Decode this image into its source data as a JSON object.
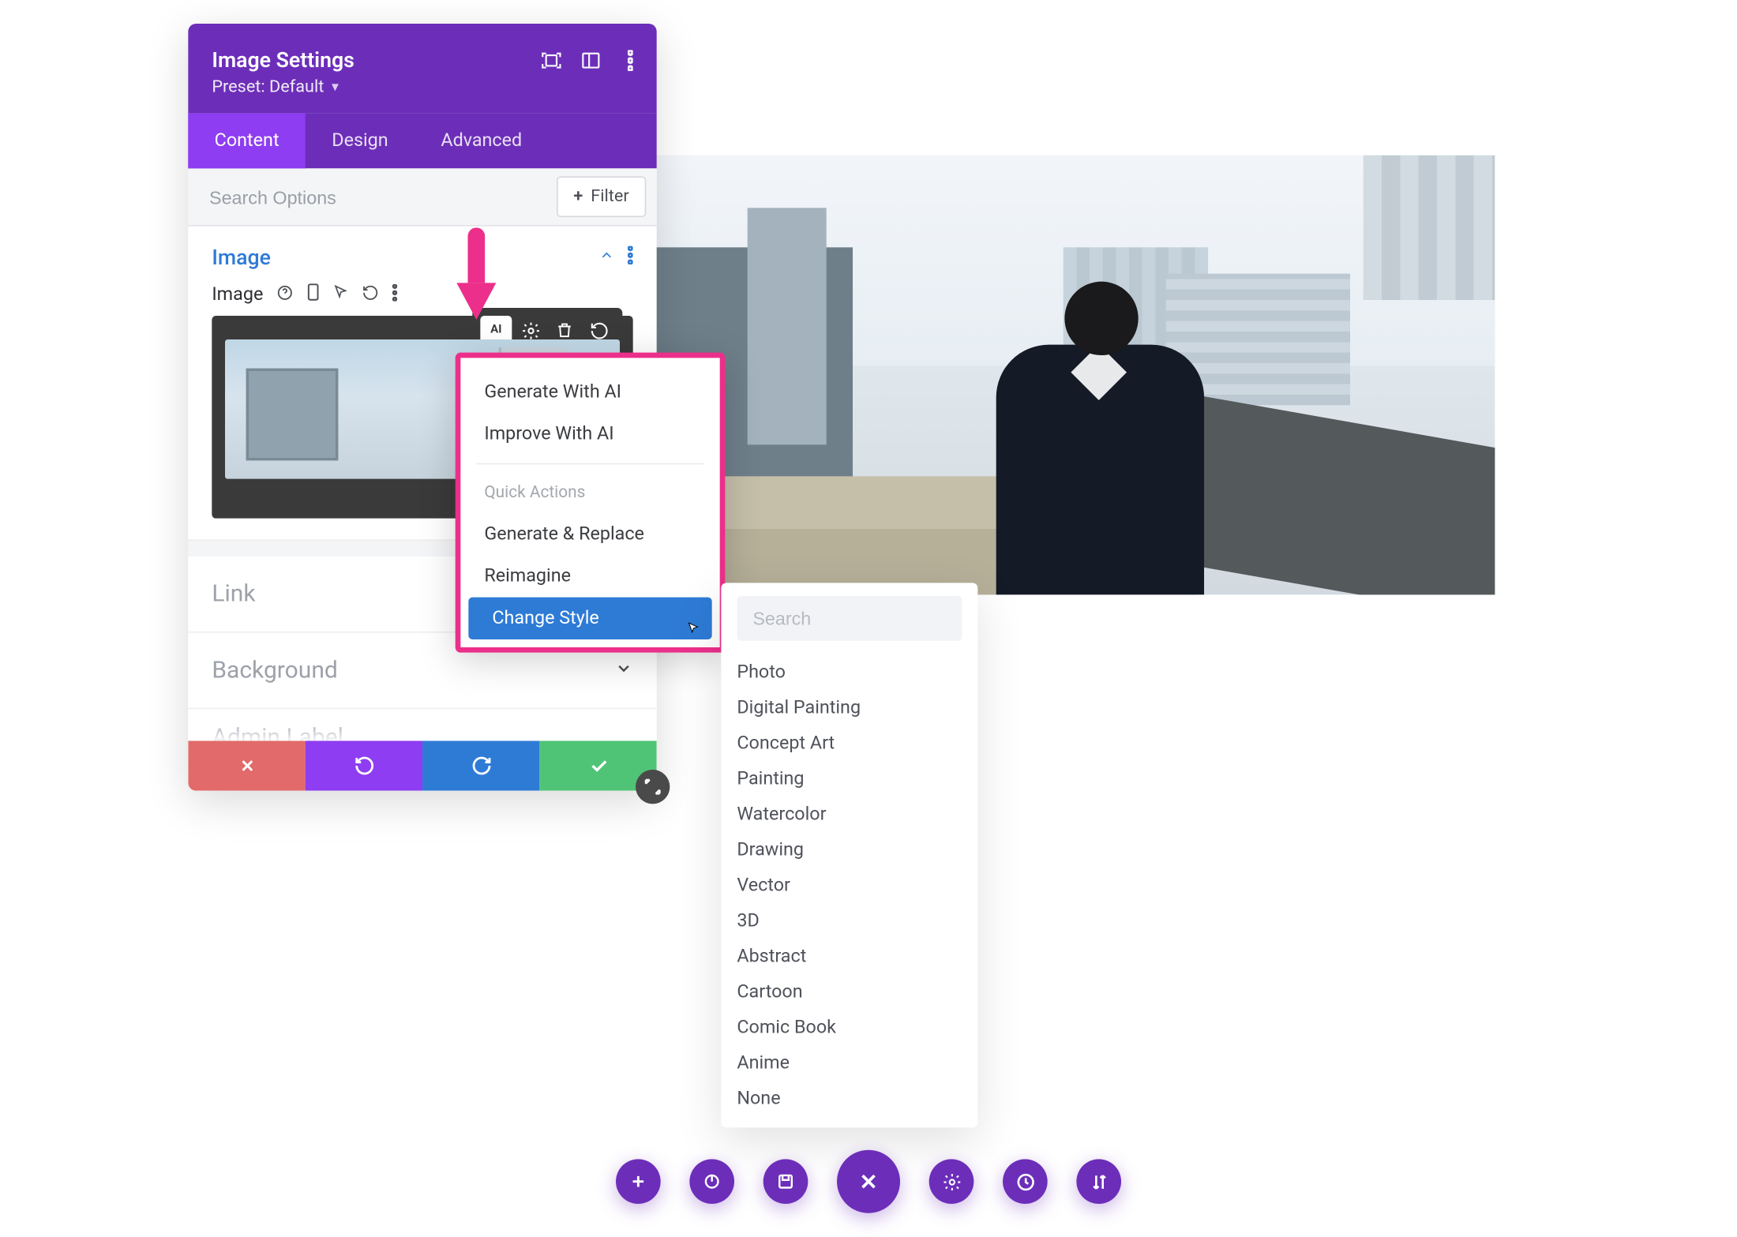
{
  "panel": {
    "title": "Image Settings",
    "preset_label": "Preset: Default",
    "tabs": {
      "content": "Content",
      "design": "Design",
      "advanced": "Advanced"
    },
    "search_placeholder": "Search Options",
    "filter_label": "Filter"
  },
  "image_section": {
    "title": "Image",
    "field_label": "Image"
  },
  "link_section": {
    "title": "Link"
  },
  "background_section": {
    "title": "Background"
  },
  "admin_section": {
    "title": "Admin Label"
  },
  "ai_menu": {
    "generate": "Generate With AI",
    "improve": "Improve With AI",
    "quick_header": "Quick Actions",
    "gen_replace": "Generate & Replace",
    "reimagine": "Reimagine",
    "change_style": "Change Style"
  },
  "style_panel": {
    "search_placeholder": "Search",
    "options": [
      "Photo",
      "Digital Painting",
      "Concept Art",
      "Painting",
      "Watercolor",
      "Drawing",
      "Vector",
      "3D",
      "Abstract",
      "Cartoon",
      "Comic Book",
      "Anime",
      "None"
    ]
  },
  "colors": {
    "purple": "#6C2EB9",
    "purple_light": "#8E3DF2",
    "pink": "#EC2F8B",
    "blue": "#2E7BD6",
    "green": "#4FC477",
    "red": "#E26A6A"
  }
}
